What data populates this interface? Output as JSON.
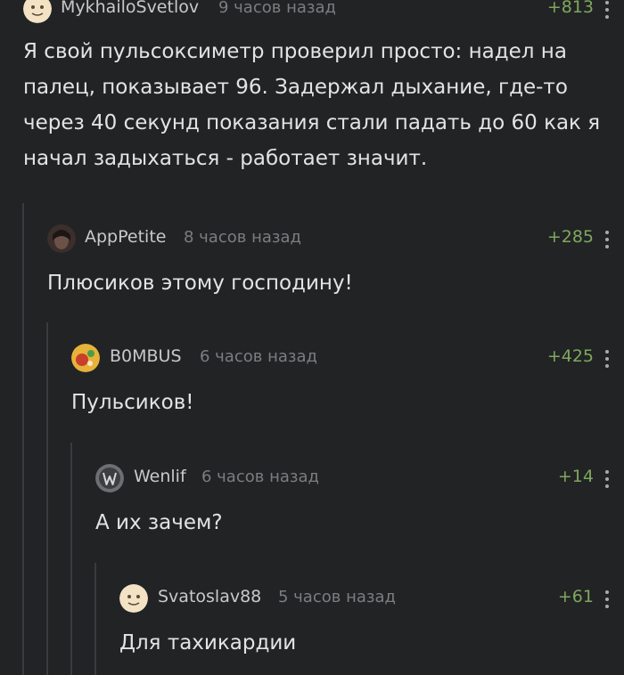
{
  "comments": [
    {
      "username": "MykhailoSvetlov",
      "timestamp": "9 часов назад",
      "rating": "+813",
      "text": "Я свой пульсоксиметр проверил просто: надел на палец, показывает 96. Задержал дыхание, где-то через 40 секунд показания стали падать до 60 как я начал задыхаться - работает значит."
    },
    {
      "username": "AppPetite",
      "timestamp": "8 часов назад",
      "rating": "+285",
      "text": "Плюсиков этому господину!"
    },
    {
      "username": "B0MBUS",
      "timestamp": "6 часов назад",
      "rating": "+425",
      "text": "Пульсиков!"
    },
    {
      "username": "Wenlif",
      "timestamp": "6 часов назад",
      "rating": "+14",
      "text": "А их зачем?"
    },
    {
      "username": "Svatoslav88",
      "timestamp": "5 часов назад",
      "rating": "+61",
      "text": "Для тахикардии"
    }
  ],
  "colors": {
    "background": "#222325",
    "thread_line": "#3a3b3e",
    "rating_positive": "#7ea85d",
    "timestamp": "#7c7d80"
  },
  "icons": {
    "more": "vertical-dots-icon"
  }
}
